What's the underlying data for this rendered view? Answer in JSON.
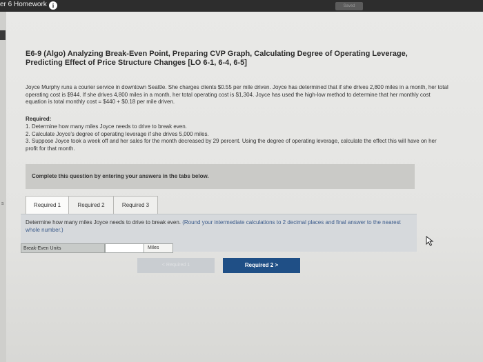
{
  "topbar": {
    "title": "er 6 Homework",
    "saved": "Saved"
  },
  "problem": {
    "heading": "E6-9 (Algo) Analyzing Break-Even Point, Preparing CVP Graph, Calculating Degree of Operating Leverage, Predicting Effect of Price Structure Changes [LO 6-1, 6-4, 6-5]",
    "paragraph": "Joyce Murphy runs a courier service in downtown Seattle. She charges clients $0.55 per mile driven. Joyce has determined that if she drives 2,800 miles in a month, her total operating cost is $944. If she drives 4,800 miles in a month, her total operating cost is $1,304. Joyce has used the high-low method to determine that her monthly cost equation is total monthly cost = $440 + $0.18 per mile driven.",
    "required_title": "Required:",
    "required_items": [
      "1. Determine how many miles Joyce needs to drive to break even.",
      "2. Calculate Joyce's degree of operating leverage if she drives 5,000 miles.",
      "3. Suppose Joyce took a week off and her sales for the month decreased by 29 percent. Using the degree of operating leverage, calculate the effect this will have on her profit for that month."
    ]
  },
  "banner": "Complete this question by entering your answers in the tabs below.",
  "tabs": [
    "Required 1",
    "Required 2",
    "Required 3"
  ],
  "question": {
    "text": "Determine how many miles Joyce needs to drive to break even.",
    "note": "(Round your intermediate calculations to 2 decimal places and final answer to the nearest whole number.)"
  },
  "answer": {
    "label": "Break-Even Units",
    "value": "",
    "unit": "Miles"
  },
  "nav": {
    "prev": "< Required 1",
    "next": "Required 2  >"
  },
  "left_marker": "s"
}
